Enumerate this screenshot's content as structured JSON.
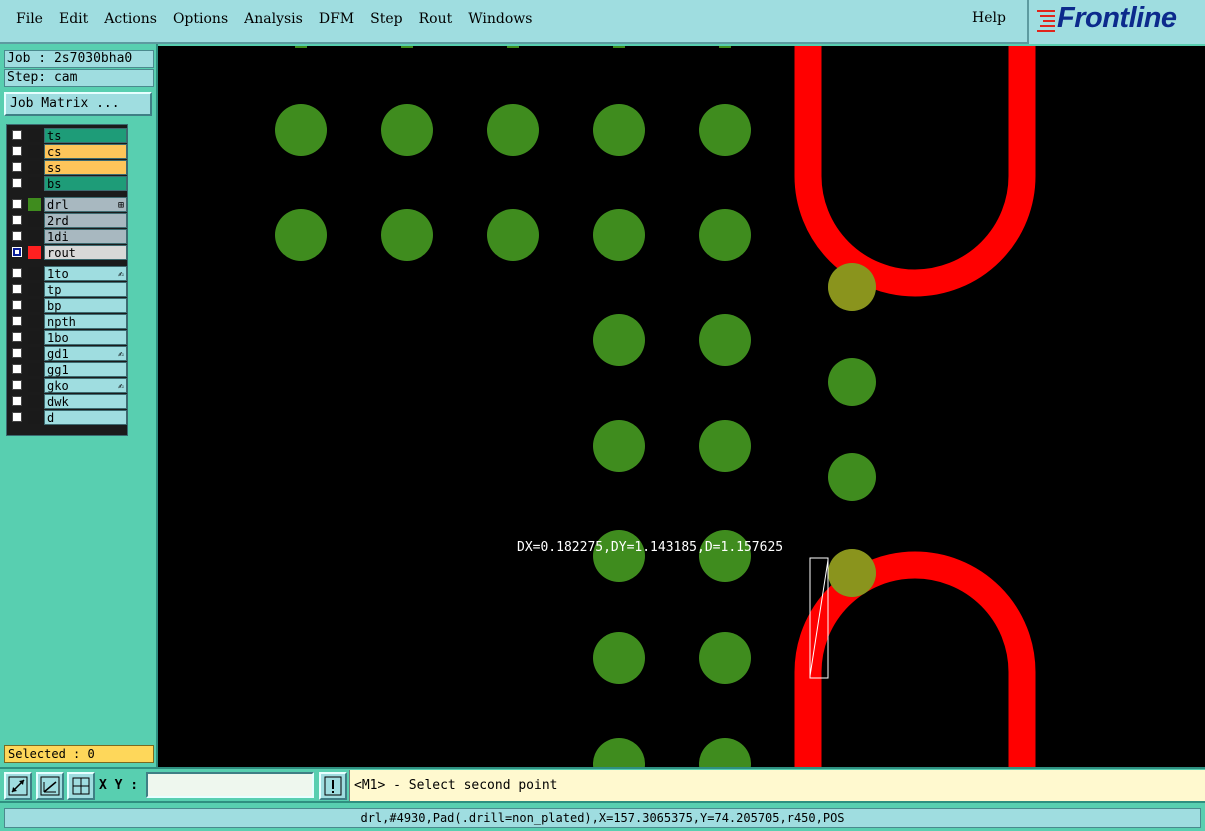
{
  "menu": {
    "items": [
      "File",
      "Edit",
      "Actions",
      "Options",
      "Analysis",
      "DFM",
      "Step",
      "Rout",
      "Windows"
    ],
    "help": "Help"
  },
  "brand": {
    "name": "Frontline",
    "color": "#0c2a8c",
    "accent": "#e0251b"
  },
  "job": {
    "job_label": "Job : 2s7030bha0",
    "step_label": "Step: cam"
  },
  "job_matrix_button": "Job Matrix ...",
  "layers": [
    {
      "name": "ts",
      "color": "#1a1a1a",
      "bg": "#1e9c78",
      "flag": ""
    },
    {
      "name": "cs",
      "color": "#1a1a1a",
      "bg": "#fec55a",
      "flag": ""
    },
    {
      "name": "ss",
      "color": "#1a1a1a",
      "bg": "#fec55a",
      "flag": ""
    },
    {
      "name": "bs",
      "color": "#1a1a1a",
      "bg": "#1e9c78",
      "flag": ""
    },
    {
      "name": "drl",
      "color": "#3f8c1e",
      "bg": "#a8b8c0",
      "flag": "⊞"
    },
    {
      "name": "2rd",
      "color": "#1a1a1a",
      "bg": "#a8b8c0",
      "flag": ""
    },
    {
      "name": "1di",
      "color": "#1a1a1a",
      "bg": "#a8b8c0",
      "flag": ""
    },
    {
      "name": "rout",
      "color": "#ff2020",
      "bg": "#d8d8d8",
      "flag": "",
      "selected": true
    },
    {
      "name": "1to",
      "color": "#1a1a1a",
      "bg": "#9fdde0",
      "flag": "✍"
    },
    {
      "name": "tp",
      "color": "#1a1a1a",
      "bg": "#9fdde0",
      "flag": ""
    },
    {
      "name": "bp",
      "color": "#1a1a1a",
      "bg": "#9fdde0",
      "flag": ""
    },
    {
      "name": "npth",
      "color": "#1a1a1a",
      "bg": "#9fdde0",
      "flag": ""
    },
    {
      "name": "1bo",
      "color": "#1a1a1a",
      "bg": "#9fdde0",
      "flag": ""
    },
    {
      "name": "gd1",
      "color": "#1a1a1a",
      "bg": "#9fdde0",
      "flag": "✍"
    },
    {
      "name": "gg1",
      "color": "#1a1a1a",
      "bg": "#9fdde0",
      "flag": ""
    },
    {
      "name": "gko",
      "color": "#1a1a1a",
      "bg": "#9fdde0",
      "flag": "✍"
    },
    {
      "name": "dwk",
      "color": "#1a1a1a",
      "bg": "#9fdde0",
      "flag": ""
    },
    {
      "name": "d",
      "color": "#1a1a1a",
      "bg": "#9fdde0",
      "flag": ""
    }
  ],
  "selected_label": "Selected : 0",
  "canvas": {
    "measure_text": "DX=0.182275,DY=1.143185,D=1.157625",
    "pad_color": "#3f8c1e",
    "rout_color": "#ff0000"
  },
  "toolbar": {
    "icons": [
      "resize-diagonal-icon",
      "measure-icon",
      "grid-icon"
    ],
    "xy_label": "X Y :",
    "xy_value": "",
    "alert_icon": "!",
    "prompt": "<M1> - Select second point"
  },
  "status": "drl,#4930,Pad(.drill=non_plated),X=157.3065375,Y=74.205705,r450,POS"
}
